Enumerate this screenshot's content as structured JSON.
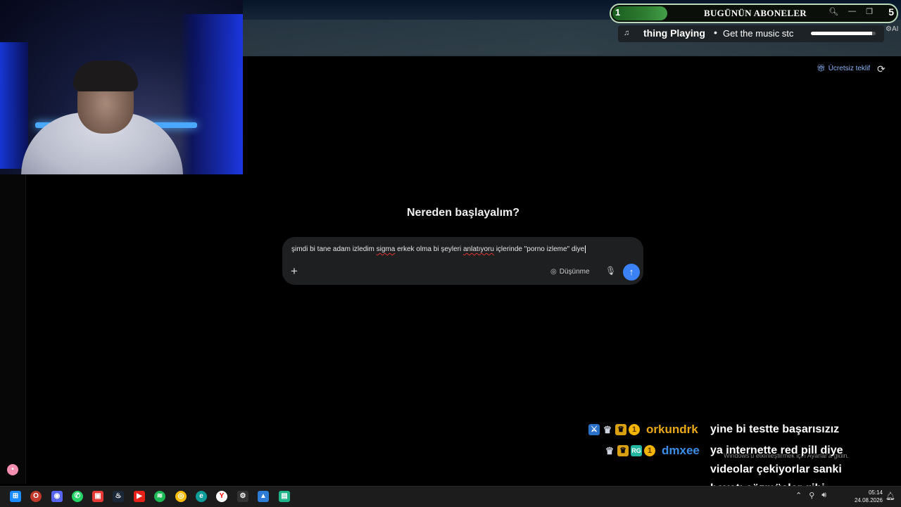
{
  "subs_widget": {
    "count": "1",
    "title": "BUGÜNÜN ABONELER",
    "end_icon": "5"
  },
  "now_playing": {
    "label": "thing Playing",
    "message": "Get the music stc",
    "progress": 0.95,
    "ai_tag": "AI"
  },
  "header": {
    "free_offer": "Ücretsiz teklif"
  },
  "main": {
    "heading": "Nereden başlayalım?",
    "prompt": {
      "text_parts": [
        "şimdi bi tane adam izledim ",
        "sigma",
        " erkek olma bi şeyleri ",
        "anlatıyoru",
        " içlerinde \"porno izleme\" diye "
      ],
      "think_label": "Düşünme"
    }
  },
  "chat": {
    "messages": [
      {
        "username": "orkundrk",
        "user_color": "#e8a817",
        "text": "yine bi testte başarısızız"
      },
      {
        "username": "dmxee",
        "user_color": "#3b8ee8",
        "text": "ya internette red pill diye videolar çekiyorlar sanki hayatı çözmüşler gibi",
        "lines": [
          "ya internette red pill diye",
          "videolar çekiyorlar sanki",
          "hayatı çözmüşler gibi"
        ]
      }
    ],
    "badges": {
      "coin": "1",
      "green": "RG"
    }
  },
  "windows_watermark": "Windows'u etkinleştirmek için Ayarlar'a gidin.",
  "taskbar": {
    "time": "05:14",
    "date": "24.08.2026"
  }
}
